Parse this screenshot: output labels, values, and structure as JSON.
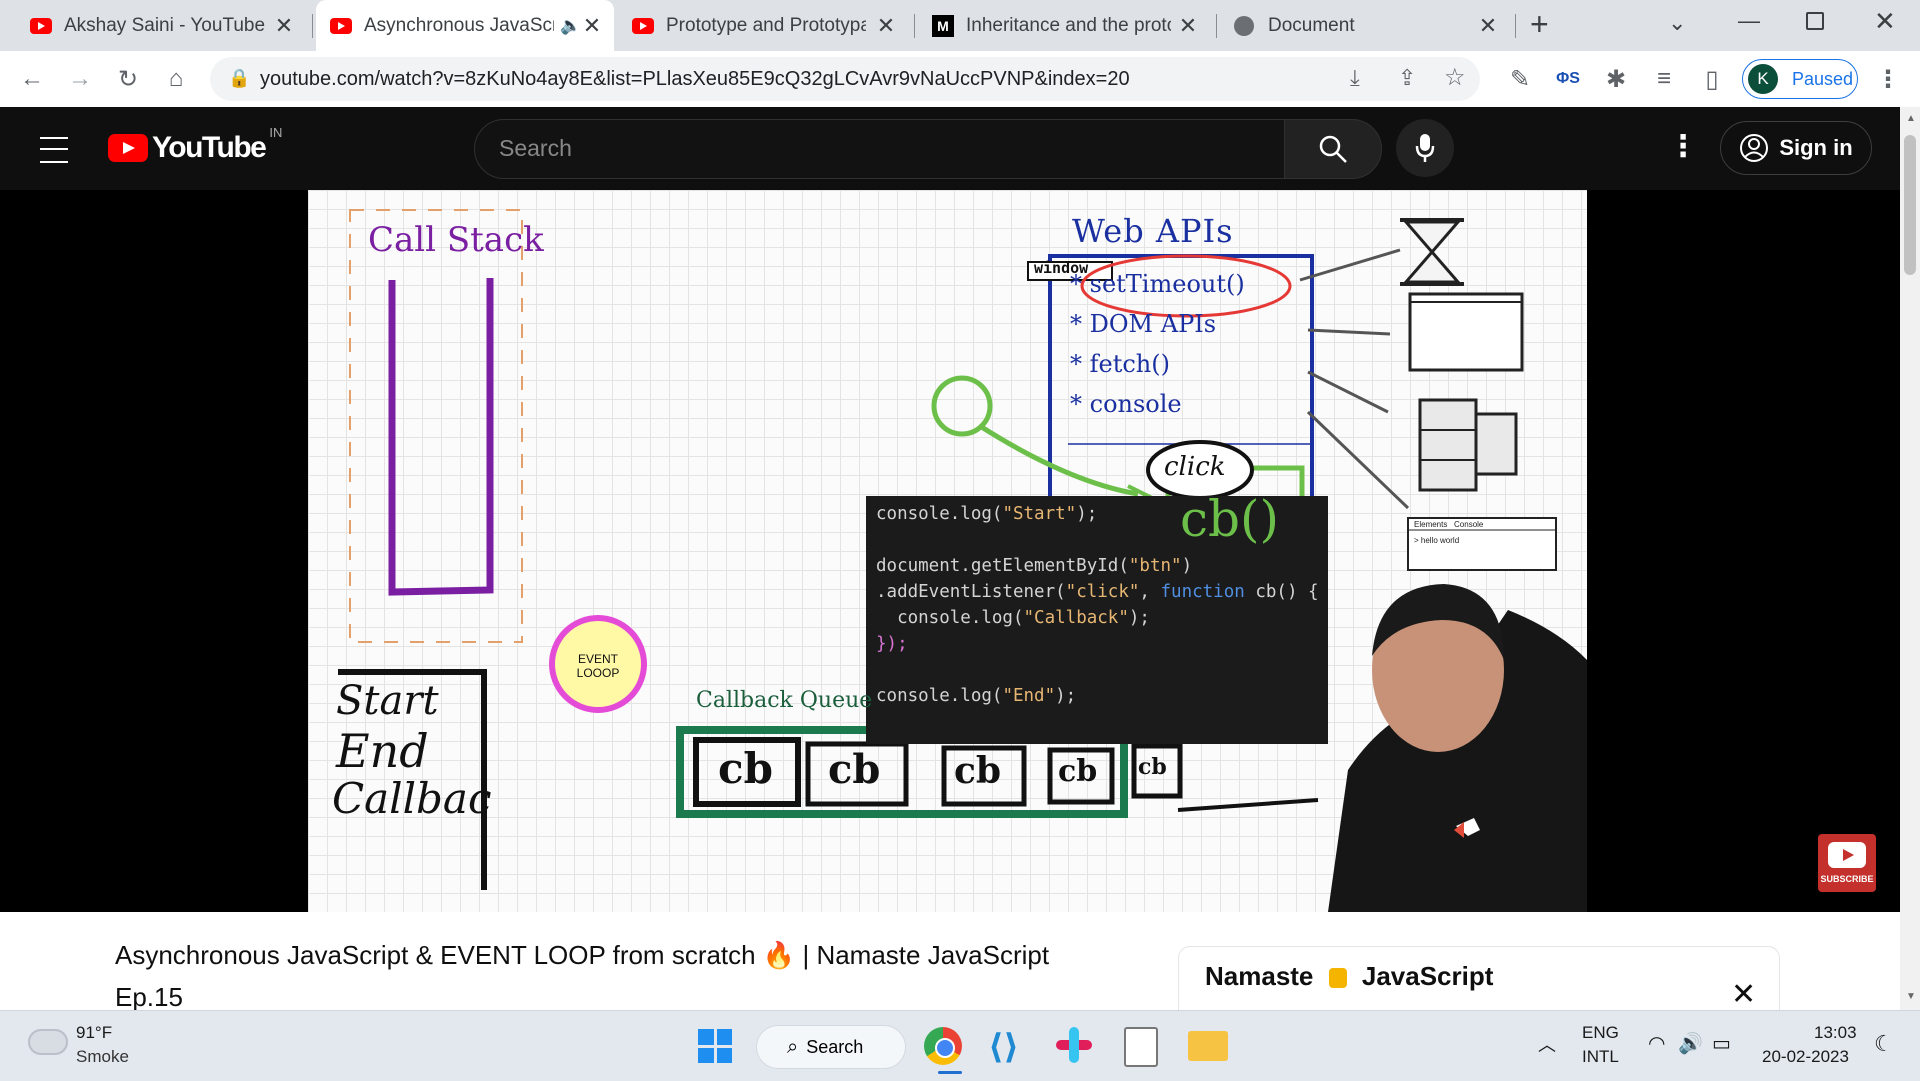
{
  "browser": {
    "tabs": [
      {
        "title": "Akshay Saini - YouTube",
        "favicon": "youtube-icon"
      },
      {
        "title": "Asynchronous JavaScri",
        "favicon": "youtube-icon",
        "audio": "speaker-icon",
        "active": true
      },
      {
        "title": "Prototype and Prototypal",
        "favicon": "youtube-icon"
      },
      {
        "title": "Inheritance and the proto",
        "favicon": "mdn-icon"
      },
      {
        "title": "Document",
        "favicon": "globe-icon"
      }
    ],
    "new_tab": "+",
    "url": "youtube.com/watch?v=8zKuNo4ay8E&list=PLlasXeu85E9cQ32gLCvAvr9vNaUccPVNP&index=20",
    "profile_initial": "K",
    "profile_status": "Paused",
    "extension_label": "ΦS"
  },
  "youtube": {
    "logo_text": "YouTube",
    "region": "IN",
    "search_placeholder": "Search",
    "sign_in": "Sign in"
  },
  "video": {
    "call_stack_title": "Call Stack",
    "web_apis_title": "Web APIs",
    "window_label": "window",
    "apis": [
      "* setTimeout()",
      "* DOM APIs",
      "* fetch()",
      "* console"
    ],
    "click_label": "click",
    "cb_label": "cb()",
    "event_loop": [
      "EVENT",
      "LOOOP"
    ],
    "callback_queue_title": "Callback Queue",
    "queue_items": [
      "cb",
      "cb",
      "cb",
      "cb",
      "cb"
    ],
    "output": [
      "Start",
      "End",
      "Callbac"
    ],
    "code": [
      "console.log(\"Start\");",
      "",
      "document.getElementById(\"btn\")",
      ".addEventListener(\"click\", function cb() {",
      "  console.log(\"Callback\");",
      "});",
      "",
      "console.log(\"End\");"
    ],
    "devtools_tabs": [
      "Elements",
      "Console"
    ],
    "devtools_output": "> hello world",
    "subscribe": "SUBSCRIBE"
  },
  "below": {
    "title_line1": "Asynchronous JavaScript & EVENT LOOP from scratch",
    "title_emoji": "🔥",
    "title_suffix": "| Namaste JavaScript",
    "title_line2": "Ep.15",
    "playlist_title_a": "Namaste",
    "playlist_title_b": "JavaScript"
  },
  "taskbar": {
    "weather_temp": "91°F",
    "weather_desc": "Smoke",
    "search_label": "Search",
    "lang_1": "ENG",
    "lang_2": "INTL",
    "time": "13:03",
    "date": "20-02-2023"
  },
  "colors": {
    "youtube_red": "#ff0000",
    "stack_purple": "#7b1fa2",
    "queue_green": "#1b7a4e",
    "cb_green": "#6cc04a",
    "web_api_blue": "#1a2fa0",
    "timeout_red": "#e53935"
  }
}
